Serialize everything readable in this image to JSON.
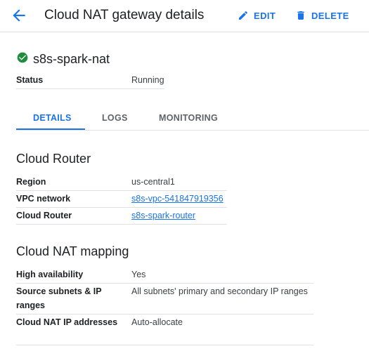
{
  "header": {
    "title": "Cloud NAT gateway details",
    "edit_label": "EDIT",
    "delete_label": "DELETE"
  },
  "gateway": {
    "name": "s8s-spark-nat",
    "status_key": "Status",
    "status_value": "Running",
    "status_color": "#1e8e3e"
  },
  "tabs": [
    {
      "label": "DETAILS",
      "active": true
    },
    {
      "label": "LOGS",
      "active": false
    },
    {
      "label": "MONITORING",
      "active": false
    }
  ],
  "cloud_router": {
    "title": "Cloud Router",
    "rows": [
      {
        "key": "Region",
        "value": "us-central1"
      },
      {
        "key": "VPC network",
        "value": "s8s-vpc-541847919356"
      },
      {
        "key": "Cloud Router",
        "value": "s8s-spark-router"
      }
    ]
  },
  "nat_mapping": {
    "title": "Cloud NAT mapping",
    "rows": [
      {
        "key": "High availability",
        "value": "Yes"
      },
      {
        "key": "Source subnets & IP ranges",
        "value": "All subnets' primary and secondary IP ranges"
      },
      {
        "key": "Cloud NAT IP addresses",
        "value": "Auto-allocate"
      }
    ]
  },
  "colors": {
    "accent": "#1a73e8",
    "divider": "#e0e0e0"
  }
}
